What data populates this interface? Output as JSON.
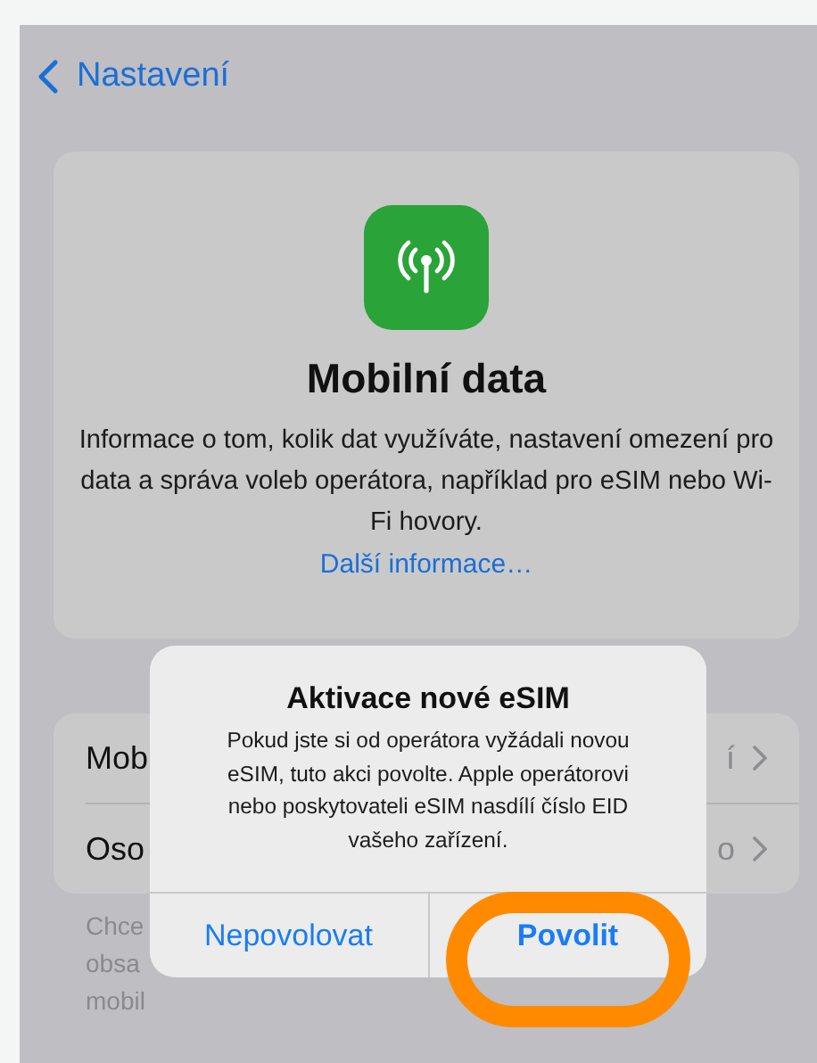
{
  "nav": {
    "back_label": "Nastavení"
  },
  "header_card": {
    "title": "Mobilní data",
    "description": "Informace o tom, kolik dat využíváte, nastavení omezení pro data a správa voleb operátora, například pro eSIM nebo Wi-Fi hovory.",
    "link": "Další informace…"
  },
  "rows": [
    {
      "label": "Mob",
      "value": "í"
    },
    {
      "label": "Oso",
      "value": "o"
    }
  ],
  "footer_lines": [
    "Chce",
    "obsa",
    "mobil"
  ],
  "alert": {
    "title": "Aktivace nové eSIM",
    "message": "Pokud jste si od operátora vyžádali novou eSIM, tuto akci povolte. Apple operátorovi nebo poskytovateli eSIM nasdílí číslo EID vašeho zařízení.",
    "buttons": [
      {
        "label": "Nepovolovat",
        "highlighted": false
      },
      {
        "label": "Povolit",
        "highlighted": true
      }
    ]
  }
}
